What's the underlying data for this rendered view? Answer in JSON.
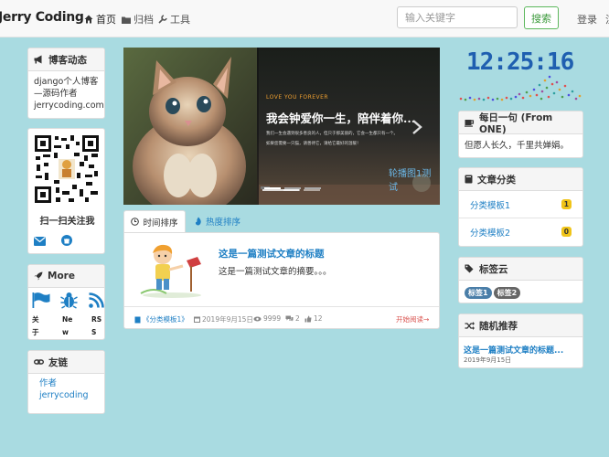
{
  "nav": {
    "brand": "Jerry Coding",
    "home": "首页",
    "archive": "归档",
    "tools": "工具",
    "search_placeholder": "输入关键字",
    "search_btn": "搜索",
    "login": "登录",
    "register": "注"
  },
  "blog_news": {
    "title": "博客动态",
    "text": "django个人博客—源码作者",
    "site": "jerrycoding.com"
  },
  "qr": {
    "caption": "扫一扫关注我"
  },
  "more": {
    "title": "More",
    "items": [
      {
        "l1": "关",
        "l2": "于"
      },
      {
        "l1": "Ne",
        "l2": "w"
      },
      {
        "l1": "RS",
        "l2": "S"
      }
    ]
  },
  "friends": {
    "title": "友链",
    "links": [
      "作者",
      "jerrycoding"
    ]
  },
  "carousel": {
    "subtitle": "LOVE YOU FOREVER",
    "headline": "我会钟爱你一生，陪伴着你...",
    "body1": "我们一生会遇到很多善良的人，但只于那美丽的，它会一生都只有一个。",
    "body2": "如果您需要一只猫，请善待它，请给它最好的温暖！",
    "caption": "轮播图1测试"
  },
  "tabs": {
    "time": "时间排序",
    "hot": "热度排序"
  },
  "article": {
    "title": "这是一篇测试文章的标题",
    "summary": "这是一篇测试文章的摘要。。。",
    "category": "《分类模板1》",
    "date": "2019年9月15日",
    "views": "9999",
    "comments": "2",
    "likes": "12",
    "read_more": "开始阅读→"
  },
  "clock": "12:25:16",
  "one": {
    "title": "每日一句 (From ONE)",
    "text": "但愿人长久，千里共婵娟。"
  },
  "categories": {
    "title": "文章分类",
    "items": [
      {
        "name": "分类模板1",
        "count": "1"
      },
      {
        "name": "分类模板2",
        "count": "0"
      }
    ]
  },
  "tags": {
    "title": "标签云",
    "items": [
      "标签1",
      "标签2"
    ]
  },
  "random": {
    "title": "随机推荐",
    "post_title": "这是一篇测试文章的标题...",
    "post_date": "2019年9月15日"
  },
  "colors": {
    "link": "#1e7fc4",
    "accent_red": "#d9534f",
    "bg": "#a9dbe1"
  }
}
